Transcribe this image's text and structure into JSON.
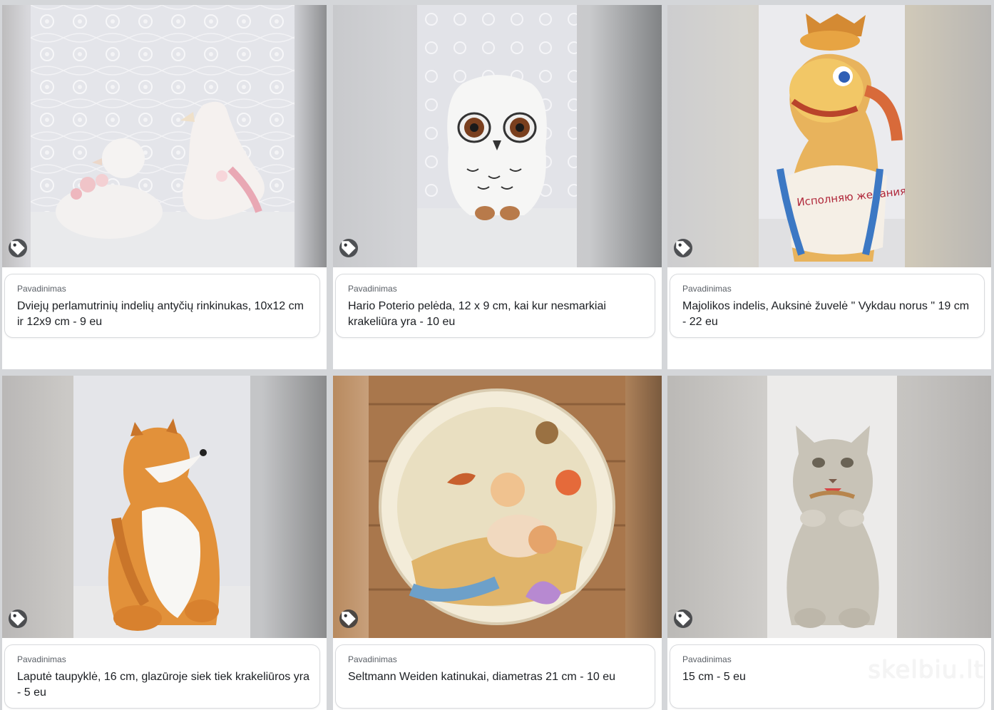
{
  "listings": [
    {
      "label": "Pavadinimas",
      "title": "Dviejų perlamutrinių indelių antyčių rinkinukas, 10x12 cm ir 12x9 cm - 9 eu",
      "image": "pearl-duck-boxes"
    },
    {
      "label": "Pavadinimas",
      "title": "Hario Poterio pelėda, 12 x 9 cm, kai kur nesmarkiai krakeliūra yra - 10 eu",
      "image": "white-owl"
    },
    {
      "label": "Pavadinimas",
      "title": "Majolikos indelis, Auksinė žuvelė \" Vykdau norus \" 19 cm - 22 eu",
      "image": "golden-fish-jar"
    },
    {
      "label": "Pavadinimas",
      "title": "Laputė taupyklė, 16 cm, glazūroje siek tiek krakeliūros yra - 5 eu",
      "image": "fox-piggy-bank"
    },
    {
      "label": "Pavadinimas",
      "title": "Seltmann Weiden katinukai, diametras 21 cm - 10 eu",
      "image": "kittens-plate"
    },
    {
      "label": "Pavadinimas",
      "title": "15 cm - 5 eu",
      "image": "cat-figurine"
    }
  ],
  "watermark": "skelbiu.lt",
  "image_texts": {
    "fish_banner": "Исполняю желания!"
  },
  "colors": {
    "page_bg": "#d4d6d9",
    "card_bg": "#ffffff",
    "tag_icon_bg": "#323438",
    "label": "#5a5f66",
    "title": "#1b1e22"
  }
}
